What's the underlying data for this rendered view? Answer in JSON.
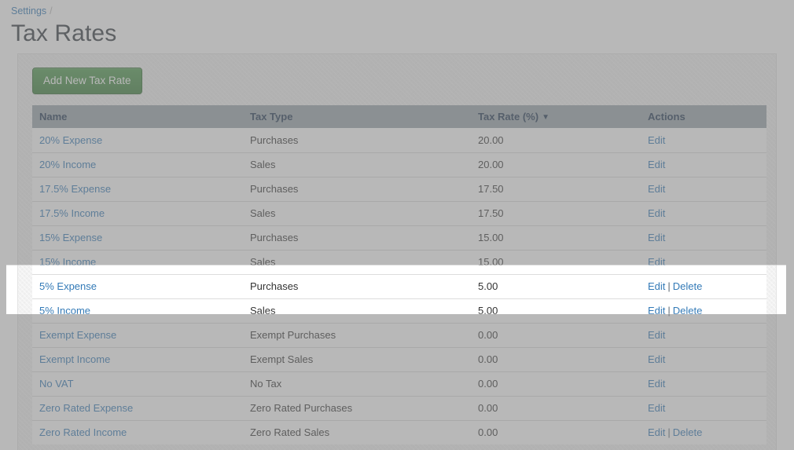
{
  "breadcrumb": {
    "parent_label": "Settings",
    "separator": "/"
  },
  "page_title": "Tax Rates",
  "toolbar": {
    "add_label": "Add New Tax Rate"
  },
  "table": {
    "columns": [
      {
        "key": "name",
        "label": "Name"
      },
      {
        "key": "type",
        "label": "Tax Type"
      },
      {
        "key": "rate",
        "label": "Tax Rate (%)"
      },
      {
        "key": "actions",
        "label": "Actions"
      }
    ],
    "sort": {
      "column": "Tax Rate (%)",
      "direction": "descending",
      "indicator": "▼"
    },
    "actions": {
      "edit_label": "Edit",
      "delete_label": "Delete",
      "separator": "|"
    },
    "rows": [
      {
        "name": "20% Expense",
        "type": "Purchases",
        "rate": "20.00",
        "has_delete": false
      },
      {
        "name": "20% Income",
        "type": "Sales",
        "rate": "20.00",
        "has_delete": false
      },
      {
        "name": "17.5% Expense",
        "type": "Purchases",
        "rate": "17.50",
        "has_delete": false
      },
      {
        "name": "17.5% Income",
        "type": "Sales",
        "rate": "17.50",
        "has_delete": false
      },
      {
        "name": "15% Expense",
        "type": "Purchases",
        "rate": "15.00",
        "has_delete": false
      },
      {
        "name": "15% Income",
        "type": "Sales",
        "rate": "15.00",
        "has_delete": false
      },
      {
        "name": "5% Expense",
        "type": "Purchases",
        "rate": "5.00",
        "has_delete": true
      },
      {
        "name": "5% Income",
        "type": "Sales",
        "rate": "5.00",
        "has_delete": true
      },
      {
        "name": "Exempt Expense",
        "type": "Exempt Purchases",
        "rate": "0.00",
        "has_delete": false
      },
      {
        "name": "Exempt Income",
        "type": "Exempt Sales",
        "rate": "0.00",
        "has_delete": false
      },
      {
        "name": "No VAT",
        "type": "No Tax",
        "rate": "0.00",
        "has_delete": false
      },
      {
        "name": "Zero Rated Expense",
        "type": "Zero Rated Purchases",
        "rate": "0.00",
        "has_delete": false
      },
      {
        "name": "Zero Rated Income",
        "type": "Zero Rated Sales",
        "rate": "0.00",
        "has_delete": true
      }
    ]
  },
  "colors": {
    "link": "#337ab7",
    "add_button": "#4e9a4e",
    "table_header_bg": "#9aa4ab",
    "table_header_text": "#1f3550",
    "page_title": "#333a40"
  }
}
